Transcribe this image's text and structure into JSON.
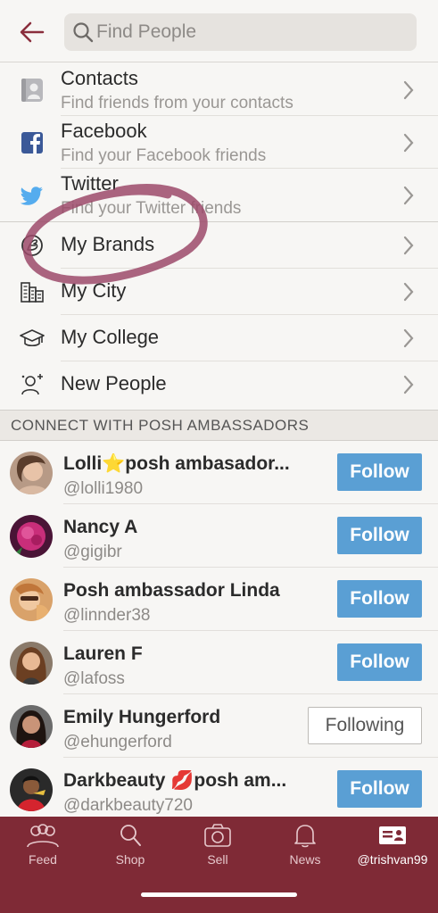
{
  "header": {
    "search_placeholder": "Find People"
  },
  "menu": [
    {
      "title": "Contacts",
      "subtitle": "Find friends from your contacts",
      "icon": "contacts-icon"
    },
    {
      "title": "Facebook",
      "subtitle": "Find your Facebook friends",
      "icon": "facebook-icon"
    },
    {
      "title": "Twitter",
      "subtitle": "Find your Twitter friends",
      "icon": "twitter-icon"
    },
    {
      "title": "My Brands",
      "icon": "brands-icon"
    },
    {
      "title": "My City",
      "icon": "city-icon"
    },
    {
      "title": "My College",
      "icon": "college-icon"
    },
    {
      "title": "New People",
      "icon": "new-people-icon"
    }
  ],
  "section_title": "CONNECT WITH POSH AMBASSADORS",
  "people": [
    {
      "name": "Lolli⭐posh ambasador...",
      "handle": "@lolli1980",
      "button": "Follow"
    },
    {
      "name": "Nancy A",
      "handle": "@gigibr",
      "button": "Follow"
    },
    {
      "name": "Posh ambassador Linda",
      "handle": "@linnder38",
      "button": "Follow"
    },
    {
      "name": "Lauren F",
      "handle": "@lafoss",
      "button": "Follow"
    },
    {
      "name": "Emily Hungerford",
      "handle": "@ehungerford",
      "button": "Following"
    },
    {
      "name": "Darkbeauty 💋posh am...",
      "handle": "@darkbeauty720",
      "button": "Follow"
    }
  ],
  "tabs": [
    {
      "label": "Feed",
      "icon": "feed-icon"
    },
    {
      "label": "Shop",
      "icon": "shop-icon"
    },
    {
      "label": "Sell",
      "icon": "camera-icon"
    },
    {
      "label": "News",
      "icon": "bell-icon"
    },
    {
      "label": "@trishvan99",
      "icon": "profile-card-icon",
      "active": true
    }
  ],
  "colors": {
    "brand": "#7f2a36",
    "follow": "#5a9fd4",
    "annotation": "#9c4a6a"
  }
}
